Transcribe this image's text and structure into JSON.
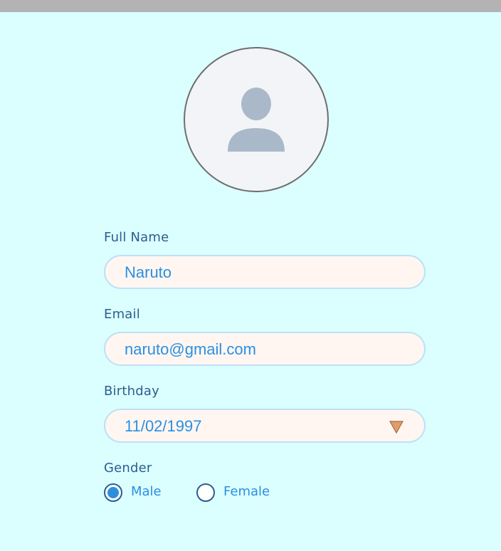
{
  "profile": {
    "avatar_icon": "user-placeholder-icon"
  },
  "form": {
    "full_name": {
      "label": "Full Name",
      "value": "Naruto"
    },
    "email": {
      "label": "Email",
      "value": "naruto@gmail.com"
    },
    "birthday": {
      "label": "Birthday",
      "value": "11/02/1997",
      "icon": "dropdown-triangle-icon"
    },
    "gender": {
      "label": "Gender",
      "options": [
        {
          "label": "Male",
          "selected": true
        },
        {
          "label": "Female",
          "selected": false
        }
      ]
    }
  },
  "colors": {
    "background": "#dbffff",
    "label_text": "#2c5e8e",
    "value_text": "#2b8fe0",
    "field_fill": "#fff6f2",
    "field_border": "#bfe0f6",
    "dropdown_arrow": "#e39b6b"
  }
}
